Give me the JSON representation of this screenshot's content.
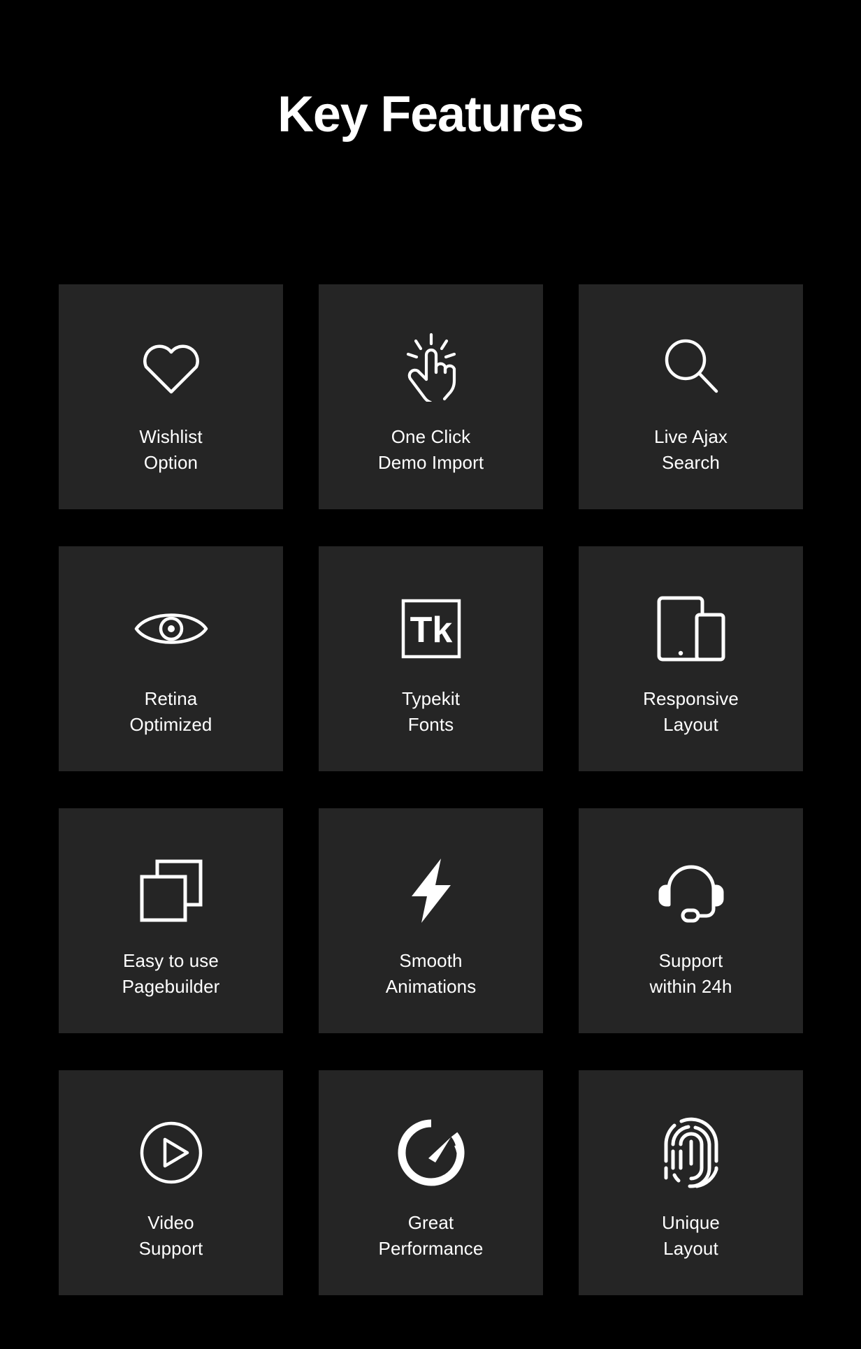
{
  "page": {
    "title": "Key Features",
    "background_color": "#000000",
    "card_color": "#252525",
    "text_color": "#ffffff"
  },
  "features": [
    {
      "icon": "heart-icon",
      "line1": "Wishlist",
      "line2": "Option"
    },
    {
      "icon": "click-hand-icon",
      "line1": "One Click",
      "line2": "Demo Import"
    },
    {
      "icon": "search-icon",
      "line1": "Live Ajax",
      "line2": "Search"
    },
    {
      "icon": "eye-icon",
      "line1": "Retina",
      "line2": "Optimized"
    },
    {
      "icon": "typekit-icon",
      "line1": "Typekit",
      "line2": "Fonts"
    },
    {
      "icon": "devices-icon",
      "line1": "Responsive",
      "line2": "Layout"
    },
    {
      "icon": "layers-icon",
      "line1": "Easy to use",
      "line2": "Pagebuilder"
    },
    {
      "icon": "lightning-bolt-icon",
      "line1": "Smooth",
      "line2": "Animations"
    },
    {
      "icon": "headset-icon",
      "line1": "Support",
      "line2": "within 24h"
    },
    {
      "icon": "play-circle-icon",
      "line1": "Video",
      "line2": "Support"
    },
    {
      "icon": "speedometer-icon",
      "line1": "Great",
      "line2": "Performance"
    },
    {
      "icon": "fingerprint-icon",
      "line1": "Unique",
      "line2": "Layout"
    }
  ]
}
